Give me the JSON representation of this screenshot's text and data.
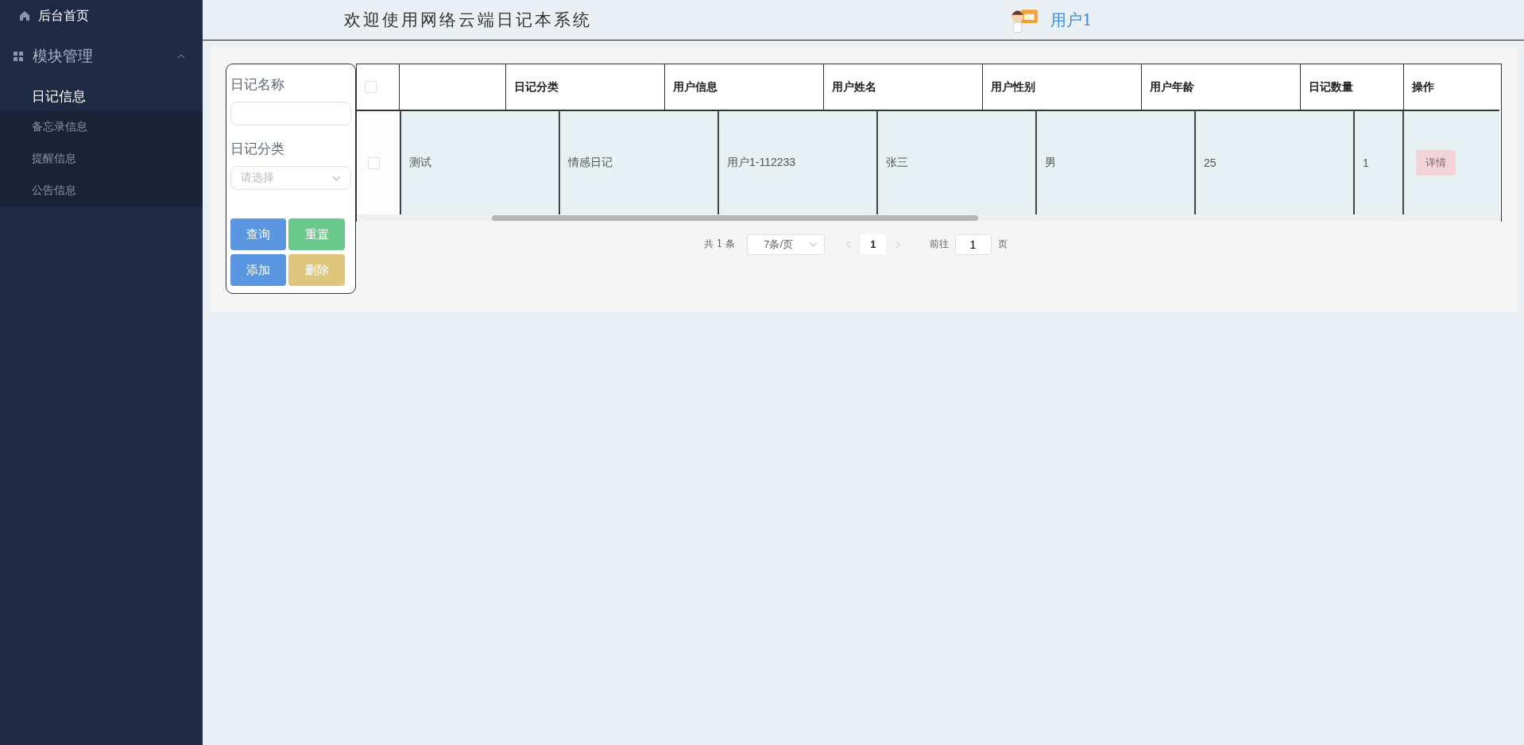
{
  "sidebar": {
    "items": [
      {
        "label": "后台首页",
        "kind": "home"
      },
      {
        "label": "模块管理",
        "kind": "group",
        "expanded": true,
        "children": [
          {
            "label": "日记信息",
            "selected": true
          },
          {
            "label": "备忘录信息",
            "selected": false
          },
          {
            "label": "提醒信息",
            "selected": false
          },
          {
            "label": "公告信息",
            "selected": false
          }
        ]
      }
    ]
  },
  "header": {
    "title": "欢迎使用网络云端日记本系统",
    "user": "用户1"
  },
  "filter": {
    "fields": [
      {
        "label": "日记名称",
        "kind": "input"
      },
      {
        "label": "日记分类",
        "kind": "select",
        "placeholder": "请选择"
      }
    ],
    "buttons": [
      {
        "label": "查询",
        "color": "#5b96e2"
      },
      {
        "label": "重置",
        "color": "#69c98a"
      },
      {
        "label": "添加",
        "color": "#5b96e2"
      },
      {
        "label": "删除",
        "color": "#dfc67d"
      }
    ]
  },
  "table": {
    "select_all_checked": false,
    "columns": [
      "",
      "日记分类",
      "用户信息",
      "用户姓名",
      "用户性别",
      "用户年龄",
      "日记数量",
      "操作"
    ],
    "rows": [
      {
        "checked": false,
        "cells": [
          "测试",
          "情感日记",
          "用户1-112233",
          "张三",
          "男",
          "25",
          "1"
        ],
        "action": "详情"
      }
    ]
  },
  "pagination": {
    "total": "共 1 条",
    "page_size": "7条/页",
    "pages": [
      {
        "label": "1",
        "selected": true
      }
    ],
    "goto_label": "前往",
    "goto_value": "1",
    "page_unit": "页"
  }
}
